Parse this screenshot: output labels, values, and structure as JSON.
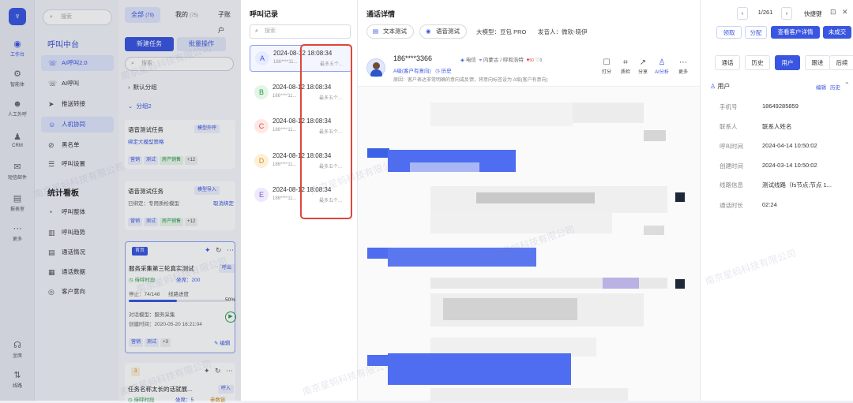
{
  "rail": {
    "items": [
      {
        "label": "工作台",
        "icon": "◉"
      },
      {
        "label": "智能体",
        "icon": "⚙"
      },
      {
        "label": "人工外呼",
        "icon": "☻"
      },
      {
        "label": "CRM",
        "icon": "♟"
      },
      {
        "label": "短信邮件",
        "icon": "✉"
      },
      {
        "label": "报表室",
        "icon": "▤"
      },
      {
        "label": "更多",
        "icon": "⋯"
      },
      {
        "label": "坐席",
        "icon": "☊"
      },
      {
        "label": "线路",
        "icon": "⇅"
      }
    ]
  },
  "nav": {
    "search": "搜索",
    "section1": "呼叫中台",
    "items1": [
      {
        "label": "AI呼叫2.0",
        "icon": "☏"
      },
      {
        "label": "AI呼叫",
        "icon": "☏"
      },
      {
        "label": "推送转接",
        "icon": "➤"
      },
      {
        "label": "人机协同",
        "icon": "☺"
      },
      {
        "label": "黑名单",
        "icon": "⊘"
      },
      {
        "label": "呼叫设置",
        "icon": "☰"
      }
    ],
    "section2": "统计看板",
    "items2": [
      {
        "label": "呼叫整体",
        "icon": "◔"
      },
      {
        "label": "呼叫趋势",
        "icon": "▥"
      },
      {
        "label": "通话情况",
        "icon": "▤"
      },
      {
        "label": "通话数据",
        "icon": "▦"
      },
      {
        "label": "客户意向",
        "icon": "◎"
      }
    ]
  },
  "tasks": {
    "tabs": [
      {
        "label": "全部",
        "count": "(79)"
      },
      {
        "label": "我的",
        "count": "(75)"
      },
      {
        "label": "子账户"
      }
    ],
    "new_btn": "新建任务",
    "batch_btn": "批量操作",
    "search": "搜索",
    "group_default": "默认分组",
    "group2": "分组2",
    "card1": {
      "title": "语音测试任务",
      "badge": "模型外呼",
      "sub": "绑定大模型策略",
      "tags": [
        "营销",
        "测试",
        "房产销售"
      ],
      "more": "+12"
    },
    "card2": {
      "title": "语音测试任务",
      "badge": "模型导入",
      "sub": "已绑定：专用质检模型",
      "cancel": "取消绑定",
      "tags": [
        "营销",
        "测试",
        "房产销售"
      ],
      "more": "+12"
    },
    "card3": {
      "badge": "首页",
      "title": "服务采集第三轮真实测试",
      "pin": "呼出",
      "state": "待呼时段",
      "seat": "坐席：200",
      "stop": "停止：74/148",
      "progress_label": "线路进度",
      "progress": "50%",
      "progress_value": 0.5,
      "model": "对话模型：服务采集",
      "created": "创建时间：2020-05-20 16:21:04",
      "tags": [
        "营销",
        "测试"
      ],
      "more": "+3",
      "edit": "编辑"
    },
    "card4": {
      "badge": "3",
      "title": "任务名称太长的话就展...",
      "pin": "呼入",
      "state": "待呼时段",
      "seat": "坐席：5",
      "link": "参数链"
    }
  },
  "callrec": {
    "title": "呼叫记录",
    "search": "搜索",
    "records": [
      {
        "letter": "A",
        "time": "2024-08-12 18:08:34",
        "phone": "186****11...",
        "summary": "最多五个..."
      },
      {
        "letter": "B",
        "time": "2024-08-12 18:08:34",
        "phone": "186****11...",
        "summary": "最多五个..."
      },
      {
        "letter": "C",
        "time": "2024-08-12 18:08:34",
        "phone": "186****11...",
        "summary": "最多五个..."
      },
      {
        "letter": "D",
        "time": "2024-08-12 18:08:34",
        "phone": "186****11...",
        "summary": "最多五个..."
      },
      {
        "letter": "E",
        "time": "2024-08-12 18:08:34",
        "phone": "186****11...",
        "summary": "最多五个..."
      }
    ]
  },
  "detail": {
    "title": "通话详情",
    "text_test": "文本测试",
    "voice_test": "语音测试",
    "model": "大模型：豆包 PRO",
    "caller": "发音人：微软-晓伊",
    "phone": "186****3366",
    "carrier": "电信",
    "location": "内蒙古 / 呼和浩特",
    "likes": "50",
    "dislikes": "0",
    "level": "A级(客户有意向)",
    "history": "历史",
    "reason": "原因：客户表达非常明确的意向或反馈，将意向标签设为 A级(客户有意向)",
    "actions": [
      {
        "label": "打分",
        "icon": "☐"
      },
      {
        "label": "质检",
        "icon": "⌗"
      },
      {
        "label": "分享",
        "icon": "↗"
      },
      {
        "label": "AI分析",
        "icon": "♙"
      },
      {
        "label": "更多",
        "icon": "⋯"
      }
    ]
  },
  "side": {
    "page": "1/261",
    "shortcut": "快捷键",
    "claim": "领取",
    "assign": "分配",
    "view_btn": "查看客户详情",
    "deal_btn": "未成交",
    "tabs": [
      "通话",
      "历史",
      "用户",
      "跟进",
      "后续"
    ],
    "section": "用户",
    "edit": "编辑",
    "hist": "历史",
    "fields": [
      {
        "k": "手机号",
        "v": "18649285859"
      },
      {
        "k": "联系人",
        "v": "联系人姓名"
      },
      {
        "k": "呼叫时间",
        "v": "2024-04-14 10:50:02"
      },
      {
        "k": "创建时间",
        "v": "2024-03-14 10:50:02"
      },
      {
        "k": "线路信息",
        "v": "测试线路（fs节点;节点 1..."
      },
      {
        "k": "通话时长",
        "v": "02:24"
      }
    ]
  },
  "watermark": "南京星蚂科技有限公司"
}
